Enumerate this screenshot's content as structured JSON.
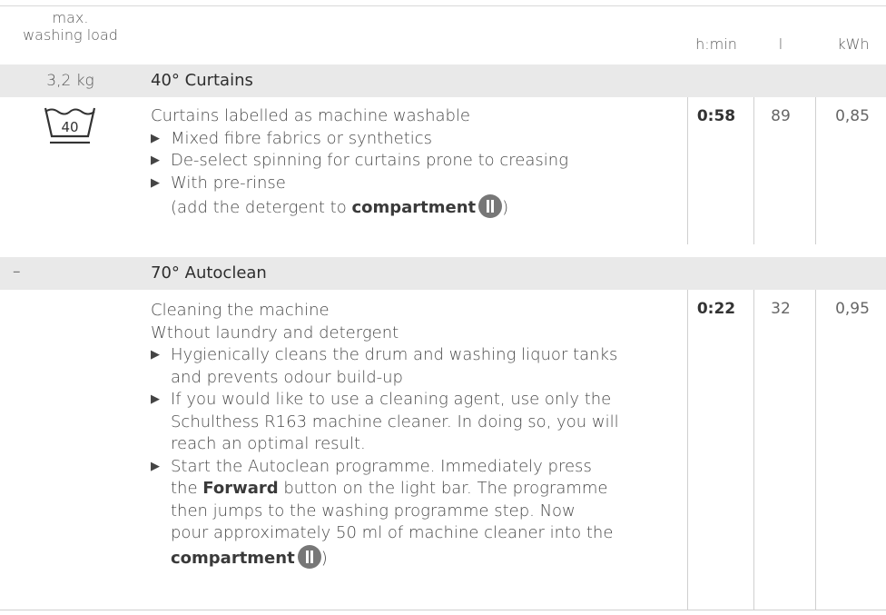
{
  "header": {
    "load_line1": "max.",
    "load_line2": "washing load",
    "time_col": "h:min",
    "litres_col": "l",
    "energy_col": "kWh"
  },
  "programmes": [
    {
      "load": "3,2 kg",
      "title": "40° Curtains",
      "icon": "wash-40-icon",
      "icon_label": "40",
      "lines": [
        "Curtains labelled as machine washable"
      ],
      "bullets": [
        "Mixed fibre fabrics or synthetics",
        "De-select spinning for curtains prone to creasing",
        "With pre-rinse"
      ],
      "note_prefix": "(add the detergent to ",
      "note_bold": "compartment",
      "note_suffix": ")",
      "time": "0:58",
      "litres": "89",
      "kwh": "0,85"
    },
    {
      "load": "–",
      "title": "70° Autoclean",
      "lines": [
        "Cleaning the machine",
        "Wthout laundry and detergent"
      ],
      "bullet1_line1": "Hygienically cleans the drum and washing liquor tanks",
      "bullet1_line2": "and prevents odour build-up",
      "bullet2_line1": "If you would like to use a cleaning agent, use only the",
      "bullet2_line2": "Schulthess R163 machine cleaner. In doing so, you will",
      "bullet2_line3": "reach an optimal result.",
      "bullet3_line1": "Start the Autoclean programme. Immediately press",
      "bullet3_line2_prefix": "the ",
      "bullet3_line2_bold": "Forward",
      "bullet3_line2_suffix": " button on the light bar. The programme",
      "bullet3_line3": "then jumps to the washing programme step. Now",
      "bullet3_line4": "pour approximately 50 ml of machine cleaner into the",
      "bullet3_bold_end": "compartment",
      "bullet3_suffix": ")",
      "time": "0:22",
      "litres": "32",
      "kwh": "0,95"
    }
  ]
}
